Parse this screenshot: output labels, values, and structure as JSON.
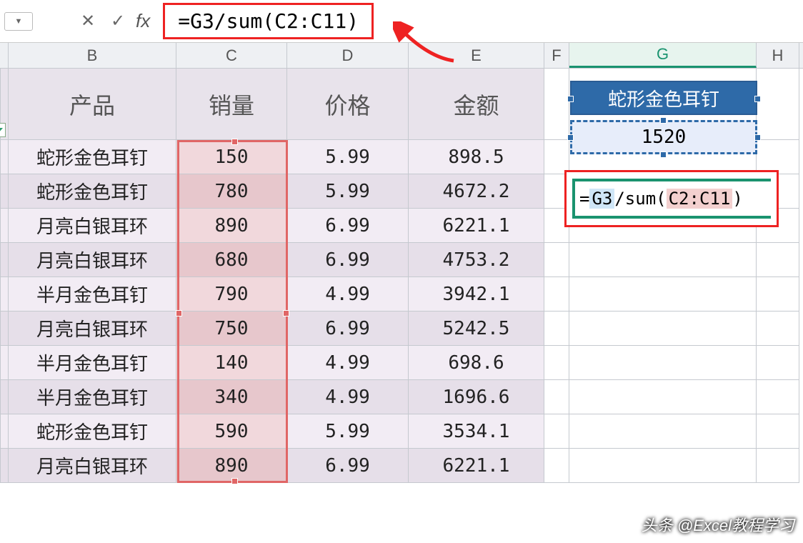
{
  "formula_bar": {
    "fx_label": "fx",
    "formula": "=G3/sum(C2:C11)"
  },
  "columns": {
    "B": "B",
    "C": "C",
    "D": "D",
    "E": "E",
    "F": "F",
    "G": "G",
    "H": "H"
  },
  "headers": {
    "product": "产品",
    "sales": "销量",
    "price": "价格",
    "amount": "金额"
  },
  "rows": [
    {
      "product": "蛇形金色耳钉",
      "sales": "150",
      "price": "5.99",
      "amount": "898.5"
    },
    {
      "product": "蛇形金色耳钉",
      "sales": "780",
      "price": "5.99",
      "amount": "4672.2"
    },
    {
      "product": "月亮白银耳环",
      "sales": "890",
      "price": "6.99",
      "amount": "6221.1"
    },
    {
      "product": "月亮白银耳环",
      "sales": "680",
      "price": "6.99",
      "amount": "4753.2"
    },
    {
      "product": "半月金色耳钉",
      "sales": "790",
      "price": "4.99",
      "amount": "3942.1"
    },
    {
      "product": "月亮白银耳环",
      "sales": "750",
      "price": "6.99",
      "amount": "5242.5"
    },
    {
      "product": "半月金色耳钉",
      "sales": "140",
      "price": "4.99",
      "amount": "698.6"
    },
    {
      "product": "半月金色耳钉",
      "sales": "340",
      "price": "4.99",
      "amount": "1696.6"
    },
    {
      "product": "蛇形金色耳钉",
      "sales": "590",
      "price": "5.99",
      "amount": "3534.1"
    },
    {
      "product": "月亮白银耳环",
      "sales": "890",
      "price": "6.99",
      "amount": "6221.1"
    }
  ],
  "side": {
    "header": "蛇形金色耳钉",
    "value": "1520",
    "formula_prefix": "=",
    "formula_g3": "G3",
    "formula_mid": "/sum(",
    "formula_range": "C2:C11",
    "formula_suffix": ")"
  },
  "watermark": "头条 @Excel教程学习"
}
